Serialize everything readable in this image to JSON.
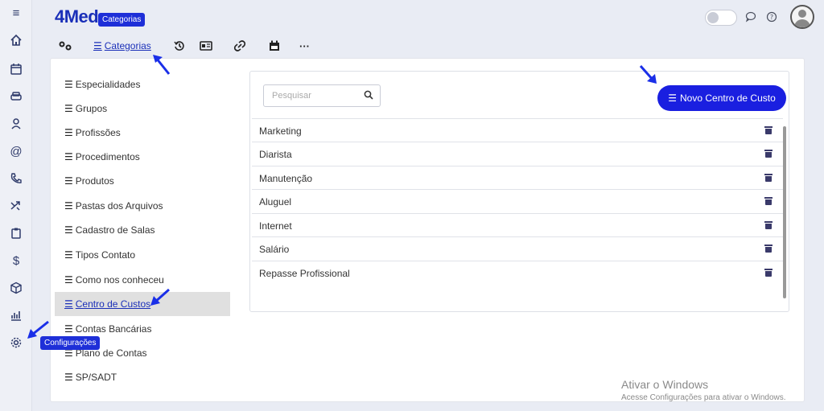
{
  "app": {
    "logo_text": "4Med"
  },
  "tooltips": {
    "categorias": "Categorias",
    "configuracoes": "Configurações"
  },
  "toolbar": {
    "categorias_label": "Categorias"
  },
  "menu": {
    "items": [
      {
        "label": "Especialidades"
      },
      {
        "label": "Grupos"
      },
      {
        "label": "Profissões"
      },
      {
        "label": "Procedimentos"
      },
      {
        "label": "Produtos"
      },
      {
        "label": "Pastas dos Arquivos"
      },
      {
        "label": "Cadastro de Salas"
      },
      {
        "label": "Tipos Contato"
      },
      {
        "label": "Como nos conheceu"
      },
      {
        "label": "Centro de Custos"
      },
      {
        "label": "Contas Bancárias"
      },
      {
        "label": "Plano de Contas"
      },
      {
        "label": "SP/SADT"
      }
    ],
    "active_index": 9
  },
  "panel": {
    "search_placeholder": "Pesquisar",
    "new_button_label": "Novo Centro de Custo",
    "rows": [
      {
        "name": "Marketing"
      },
      {
        "name": "Diarista"
      },
      {
        "name": "Manutenção"
      },
      {
        "name": "Aluguel"
      },
      {
        "name": "Internet"
      },
      {
        "name": "Salário"
      },
      {
        "name": "Repasse Profissional"
      }
    ]
  },
  "watermark": {
    "title": "Ativar o Windows",
    "subtitle": "Acesse Configurações para ativar o Windows."
  },
  "colors": {
    "accent": "#1a1fe0",
    "tooltip": "#1e2fd8",
    "logo": "#1a2fb8"
  }
}
